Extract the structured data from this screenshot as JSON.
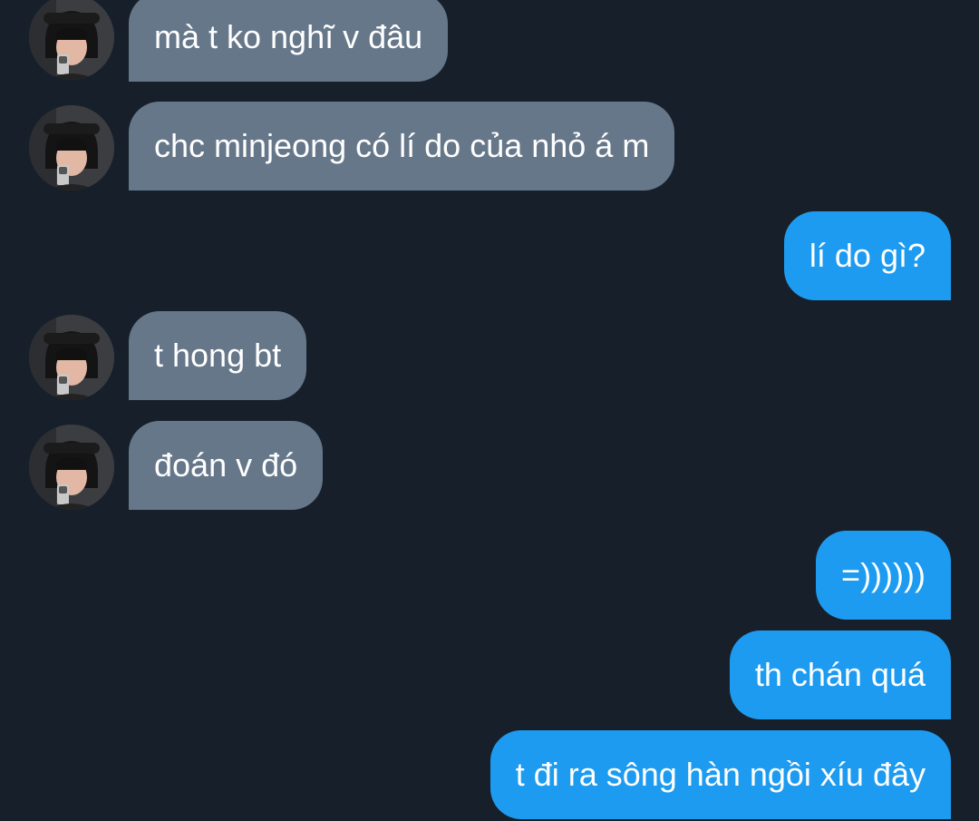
{
  "conversation": {
    "messages": [
      {
        "direction": "received",
        "text": "mà t ko nghĩ v đâu"
      },
      {
        "direction": "received",
        "text": "chc minjeong có lí do của nhỏ á m"
      },
      {
        "direction": "sent",
        "text": "lí do gì?"
      },
      {
        "direction": "received",
        "text": "t hong bt"
      },
      {
        "direction": "received",
        "text": "đoán v đó"
      },
      {
        "direction": "sent",
        "text": "=))))))"
      },
      {
        "direction": "sent",
        "text": "th chán quá"
      },
      {
        "direction": "sent",
        "text": "t đi ra sông hàn ngồi xíu đây"
      }
    ]
  },
  "colors": {
    "background": "#17202a",
    "received_bubble": "#66778a",
    "sent_bubble": "#1d9bf0",
    "text": "#ffffff"
  }
}
